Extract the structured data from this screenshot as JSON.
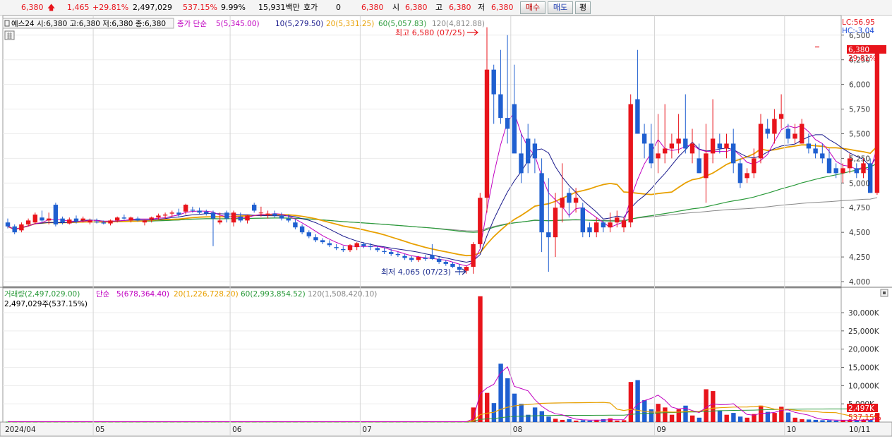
{
  "topbar": {
    "price": "6,380",
    "change": "1,465",
    "change_pct": "+29.81%",
    "volume": "2,497,029",
    "volume_ratio": "537.15%",
    "turnover": "9.99%",
    "amount": "15,931백만",
    "quote_label": "호가",
    "quote_value": "0",
    "last_price": "6,380",
    "open_label": "시",
    "open_value": "6,380",
    "high_label": "고",
    "high_value": "6,380",
    "low_label": "저",
    "low_value": "6,380",
    "buy_label": "매수",
    "sell_label": "매도",
    "even_label": "평"
  },
  "price_panel": {
    "title": "예스24 시:6,380 고:6,380 저:6,380 종:6,380",
    "ma_label": "종가 단순",
    "ma5": "5(5,345.00)",
    "ma10": "10(5,279.50)",
    "ma20": "20(5,331.25)",
    "ma60": "60(5,057.83)",
    "ma120": "120(4,812.88)",
    "high_annotation": "최고 6,580 (07/25)",
    "low_annotation": "최저 4,065 (07/23)",
    "lc": "LC:56.95",
    "hc": "HC:-3.04",
    "current_price_tag": "6,380",
    "current_pct_tag": "29.81%"
  },
  "volume_panel": {
    "title": "거래량(2,497,029.00)",
    "ma_label": "단순",
    "ma5": "5(678,364.40)",
    "ma20": "20(1,226,728.20)",
    "ma60": "60(2,993,854.52)",
    "ma120": "120(1,508,420.10)",
    "current": "2,497,029주(537.15%)",
    "volume_tag": "2,497K",
    "volume_pct_tag": "537.15%"
  },
  "colors": {
    "up": "#e8141b",
    "down": "#1f5fd0",
    "ma5": "#c000c0",
    "ma10": "#1a1a8c",
    "ma20": "#e8a000",
    "ma60": "#2a9a3a",
    "ma120": "#888888"
  },
  "chart_data": [
    {
      "type": "candlestick",
      "panel": "price",
      "ylim": [
        3950,
        6620
      ],
      "y_ticks": [
        "4,000",
        "4,250",
        "4,500",
        "4,750",
        "5,000",
        "5,250",
        "5,500",
        "5,750",
        "6,000",
        "6,250",
        "6,500"
      ],
      "x_ticks": [
        "2024/04",
        "05",
        "06",
        "07",
        "08",
        "09",
        "10",
        "10/11"
      ],
      "candles": [
        [
          4600,
          4640,
          4540,
          4560
        ],
        [
          4560,
          4580,
          4480,
          4500
        ],
        [
          4520,
          4600,
          4500,
          4580
        ],
        [
          4580,
          4640,
          4560,
          4620
        ],
        [
          4600,
          4700,
          4580,
          4680
        ],
        [
          4650,
          4720,
          4600,
          4620
        ],
        [
          4620,
          4700,
          4580,
          4640
        ],
        [
          4780,
          4800,
          4560,
          4580
        ],
        [
          4640,
          4660,
          4580,
          4600
        ],
        [
          4590,
          4650,
          4580,
          4630
        ],
        [
          4640,
          4670,
          4590,
          4610
        ],
        [
          4620,
          4660,
          4600,
          4640
        ],
        [
          4600,
          4640,
          4580,
          4620
        ],
        [
          4610,
          4640,
          4590,
          4600
        ],
        [
          4600,
          4620,
          4580,
          4590
        ],
        [
          4590,
          4630,
          4570,
          4620
        ],
        [
          4620,
          4660,
          4600,
          4650
        ],
        [
          4650,
          4680,
          4630,
          4640
        ],
        [
          4620,
          4660,
          4600,
          4650
        ],
        [
          4640,
          4660,
          4610,
          4620
        ],
        [
          4600,
          4630,
          4570,
          4620
        ],
        [
          4630,
          4660,
          4600,
          4650
        ],
        [
          4650,
          4690,
          4630,
          4670
        ],
        [
          4670,
          4700,
          4640,
          4680
        ],
        [
          4690,
          4720,
          4660,
          4700
        ],
        [
          4700,
          4740,
          4650,
          4680
        ],
        [
          4710,
          4790,
          4680,
          4780
        ],
        [
          4730,
          4760,
          4700,
          4720
        ],
        [
          4720,
          4750,
          4680,
          4700
        ],
        [
          4710,
          4730,
          4670,
          4690
        ],
        [
          4700,
          4720,
          4360,
          4640
        ],
        [
          4600,
          4700,
          4580,
          4620
        ],
        [
          4700,
          4720,
          4600,
          4640
        ],
        [
          4600,
          4720,
          4560,
          4700
        ],
        [
          4660,
          4700,
          4600,
          4620
        ],
        [
          4620,
          4680,
          4590,
          4670
        ],
        [
          4780,
          4800,
          4700,
          4720
        ],
        [
          4700,
          4760,
          4660,
          4700
        ],
        [
          4680,
          4720,
          4640,
          4690
        ],
        [
          4690,
          4720,
          4650,
          4670
        ],
        [
          4670,
          4700,
          4620,
          4640
        ],
        [
          4640,
          4680,
          4600,
          4620
        ],
        [
          4600,
          4630,
          4530,
          4550
        ],
        [
          4560,
          4580,
          4480,
          4500
        ],
        [
          4500,
          4520,
          4440,
          4460
        ],
        [
          4450,
          4480,
          4400,
          4420
        ],
        [
          4420,
          4440,
          4380,
          4400
        ],
        [
          4390,
          4420,
          4350,
          4370
        ],
        [
          4350,
          4380,
          4320,
          4340
        ],
        [
          4330,
          4360,
          4300,
          4320
        ],
        [
          4320,
          4380,
          4300,
          4370
        ],
        [
          4350,
          4400,
          4320,
          4390
        ],
        [
          4380,
          4400,
          4340,
          4360
        ],
        [
          4360,
          4390,
          4320,
          4350
        ],
        [
          4340,
          4360,
          4300,
          4320
        ],
        [
          4310,
          4340,
          4280,
          4300
        ],
        [
          4300,
          4330,
          4260,
          4280
        ],
        [
          4280,
          4300,
          4250,
          4270
        ],
        [
          4260,
          4280,
          4220,
          4240
        ],
        [
          4240,
          4260,
          4200,
          4220
        ],
        [
          4220,
          4260,
          4200,
          4250
        ],
        [
          4240,
          4270,
          4210,
          4230
        ],
        [
          4270,
          4380,
          4220,
          4230
        ],
        [
          4230,
          4250,
          4180,
          4200
        ],
        [
          4200,
          4220,
          4160,
          4180
        ],
        [
          4180,
          4200,
          4140,
          4150
        ],
        [
          4150,
          4180,
          4065,
          4120
        ],
        [
          4110,
          4160,
          4080,
          4150
        ],
        [
          4150,
          4400,
          4080,
          4380
        ],
        [
          4380,
          4900,
          4340,
          4850
        ],
        [
          4850,
          6580,
          4700,
          6150
        ],
        [
          6150,
          6200,
          5600,
          5900
        ],
        [
          5900,
          6350,
          5600,
          5660
        ],
        [
          5660,
          6500,
          5400,
          5550
        ],
        [
          5800,
          6200,
          5500,
          5300
        ],
        [
          5300,
          5500,
          5000,
          5100
        ],
        [
          5450,
          5600,
          5100,
          5200
        ],
        [
          5400,
          5450,
          5100,
          5250
        ],
        [
          5100,
          5250,
          4300,
          4500
        ],
        [
          4500,
          5050,
          4100,
          4450
        ],
        [
          4450,
          4900,
          4250,
          4750
        ],
        [
          4750,
          5200,
          4600,
          4850
        ],
        [
          4900,
          4950,
          4650,
          4800
        ],
        [
          4800,
          4950,
          4700,
          4850
        ],
        [
          4750,
          4800,
          4450,
          4500
        ],
        [
          4550,
          4600,
          4450,
          4500
        ],
        [
          4500,
          4650,
          4450,
          4600
        ],
        [
          4600,
          4620,
          4500,
          4550
        ],
        [
          4550,
          4700,
          4500,
          4600
        ],
        [
          4600,
          4720,
          4550,
          4650
        ],
        [
          4550,
          4650,
          4500,
          4620
        ],
        [
          4600,
          5900,
          4550,
          5800
        ],
        [
          5850,
          6350,
          5500,
          5500
        ],
        [
          5500,
          5600,
          5250,
          5400
        ],
        [
          5400,
          5600,
          5150,
          5200
        ],
        [
          5250,
          5700,
          5100,
          5300
        ],
        [
          5300,
          5800,
          5200,
          5350
        ],
        [
          5350,
          5500,
          5250,
          5400
        ],
        [
          5400,
          5700,
          5300,
          5450
        ],
        [
          5450,
          5900,
          5300,
          5350
        ],
        [
          5300,
          5550,
          5200,
          5400
        ],
        [
          5250,
          5400,
          5100,
          5100
        ],
        [
          5050,
          5600,
          4800,
          5300
        ],
        [
          5300,
          5850,
          5200,
          5450
        ],
        [
          5400,
          5500,
          5300,
          5350
        ],
        [
          5350,
          5500,
          5250,
          5400
        ],
        [
          5400,
          5550,
          5100,
          5200
        ],
        [
          5200,
          5250,
          4950,
          5000
        ],
        [
          5050,
          5150,
          5000,
          5100
        ],
        [
          5100,
          5350,
          5050,
          5250
        ],
        [
          5250,
          5700,
          5200,
          5600
        ],
        [
          5550,
          5650,
          5450,
          5500
        ],
        [
          5500,
          5750,
          5400,
          5650
        ],
        [
          5650,
          5900,
          5550,
          5700
        ],
        [
          5550,
          5600,
          5400,
          5450
        ],
        [
          5450,
          5600,
          5400,
          5500
        ],
        [
          5400,
          5650,
          5400,
          5600
        ],
        [
          5400,
          5500,
          5300,
          5350
        ],
        [
          5350,
          5400,
          5250,
          5300
        ],
        [
          5300,
          5400,
          5200,
          5250
        ],
        [
          5250,
          5350,
          5100,
          5100
        ],
        [
          5150,
          5200,
          5050,
          5100
        ],
        [
          5100,
          5200,
          5000,
          5150
        ],
        [
          5150,
          5300,
          5100,
          5250
        ],
        [
          5150,
          5200,
          5050,
          5100
        ],
        [
          5100,
          5250,
          5050,
          5200
        ],
        [
          5200,
          5250,
          4900,
          4900
        ],
        [
          4900,
          6380,
          4880,
          6380
        ]
      ],
      "volume_ylim": [
        0,
        36000
      ],
      "volume_ticks": [
        "5,000K",
        "10,000K",
        "15,000K",
        "20,000K",
        "25,000K",
        "30,000K"
      ],
      "volume_k": [
        100,
        100,
        100,
        100,
        100,
        100,
        100,
        100,
        100,
        100,
        100,
        100,
        100,
        100,
        100,
        100,
        100,
        100,
        100,
        100,
        100,
        100,
        100,
        100,
        100,
        100,
        100,
        100,
        100,
        100,
        100,
        100,
        100,
        100,
        100,
        100,
        100,
        100,
        100,
        100,
        100,
        100,
        100,
        100,
        100,
        100,
        100,
        100,
        100,
        100,
        100,
        100,
        100,
        100,
        100,
        100,
        100,
        100,
        100,
        100,
        100,
        100,
        100,
        100,
        100,
        100,
        100,
        100,
        4000,
        34500,
        8000,
        5200,
        16000,
        12000,
        7800,
        5000,
        2000,
        4000,
        3000,
        1500,
        900,
        600,
        800,
        400,
        500,
        400,
        600,
        800,
        1000,
        400,
        500,
        11000,
        11500,
        6000,
        3500,
        5000,
        4000,
        2000,
        3500,
        4500,
        1800,
        1200,
        9000,
        8500,
        3200,
        2000,
        2500,
        1500,
        1200,
        2200,
        4500,
        2800,
        2500,
        4200,
        2600,
        1200,
        800,
        700,
        600,
        500,
        500,
        400,
        500,
        600,
        400,
        700,
        600,
        2497
      ]
    }
  ]
}
